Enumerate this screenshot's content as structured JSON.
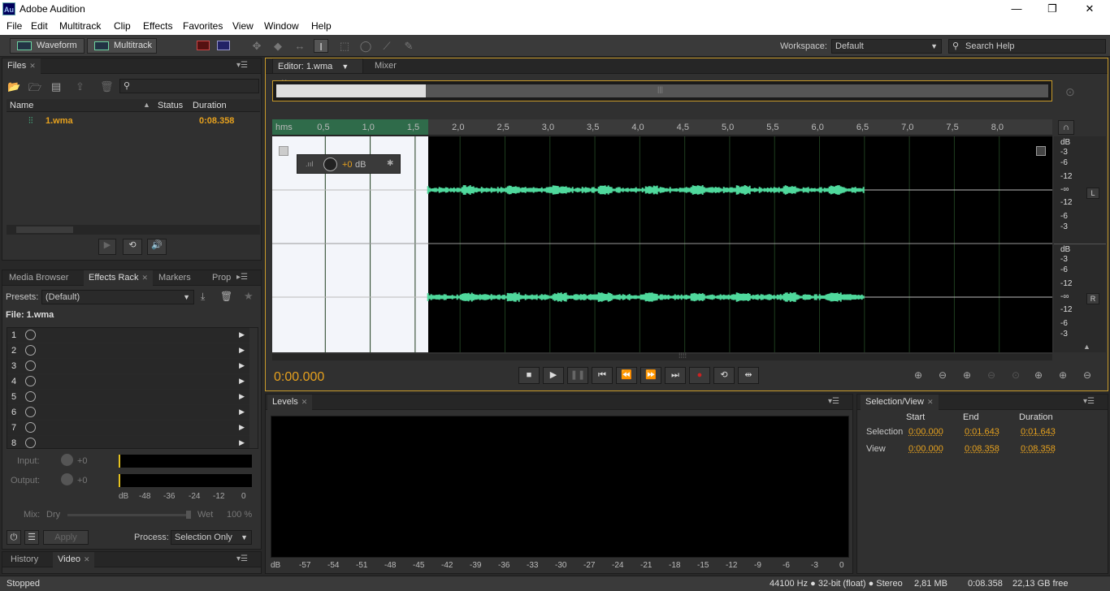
{
  "window": {
    "title": "Adobe Audition",
    "icon_text": "Au",
    "minimize": "—",
    "maximize": "❐",
    "close": "✕"
  },
  "menu": [
    "File",
    "Edit",
    "Multitrack",
    "Clip",
    "Effects",
    "Favorites",
    "View",
    "Window",
    "Help"
  ],
  "toolbar": {
    "waveform": "Waveform",
    "multitrack": "Multitrack",
    "workspace_label": "Workspace:",
    "workspace_value": "Default",
    "search_placeholder": "Search Help"
  },
  "files": {
    "tab": "Files",
    "columns": {
      "name": "Name",
      "status": "Status",
      "duration": "Duration"
    },
    "rows": [
      {
        "name": "1.wma",
        "status": "",
        "duration": "0:08.358"
      }
    ]
  },
  "effects": {
    "tabs": [
      "Media Browser",
      "Effects Rack",
      "Markers",
      "Prop"
    ],
    "presets_label": "Presets:",
    "presets_value": "(Default)",
    "file_label": "File: 1.wma",
    "slots": [
      "1",
      "2",
      "3",
      "4",
      "5",
      "6",
      "7",
      "8"
    ],
    "input_label": "Input:",
    "output_label": "Output:",
    "input_value": "+0",
    "output_value": "+0",
    "meter_scale": [
      "dB",
      "-48",
      "-36",
      "-24",
      "-12",
      "0"
    ],
    "mix_label": "Mix:",
    "mix_dry": "Dry",
    "mix_wet": "Wet",
    "mix_value": "100 %",
    "apply": "Apply",
    "process_label": "Process:",
    "process_value": "Selection Only"
  },
  "bottom_tabs": [
    "History",
    "Video"
  ],
  "editor": {
    "tab": "Editor: 1.wma",
    "mixer_tab": "Mixer",
    "ruler": [
      "hms",
      "0,5",
      "1,0",
      "1,5",
      "2,0",
      "2,5",
      "3,0",
      "3,5",
      "4,0",
      "4,5",
      "5,0",
      "5,5",
      "6,0",
      "6,5",
      "7,0",
      "7,5",
      "8,0"
    ],
    "hud_value": "+0",
    "hud_unit": "dB",
    "db_scale_top": [
      "dB",
      "-3",
      "-6",
      "-12",
      "-∞",
      "-12",
      "-6",
      "-3"
    ],
    "db_scale_bottom": [
      "dB",
      "-3",
      "-6",
      "-12",
      "-∞",
      "-12",
      "-6",
      "-3"
    ],
    "channel_L": "L",
    "channel_R": "R",
    "time_display": "0:00.000",
    "duration_seconds": 8.358,
    "selection_end_seconds": 1.643
  },
  "levels": {
    "tab": "Levels",
    "scale": [
      "dB",
      "-57",
      "-54",
      "-51",
      "-48",
      "-45",
      "-42",
      "-39",
      "-36",
      "-33",
      "-30",
      "-27",
      "-24",
      "-21",
      "-18",
      "-15",
      "-12",
      "-9",
      "-6",
      "-3",
      "0"
    ]
  },
  "selection_view": {
    "tab": "Selection/View",
    "headers": [
      "Start",
      "End",
      "Duration"
    ],
    "selection_label": "Selection",
    "selection": [
      "0:00.000",
      "0:01.643",
      "0:01.643"
    ],
    "view_label": "View",
    "view": [
      "0:00.000",
      "0:08.358",
      "0:08.358"
    ]
  },
  "status": {
    "left": "Stopped",
    "format": "44100 Hz ● 32-bit (float) ● Stereo",
    "size": "2,81 MB",
    "duration": "0:08.358",
    "free": "22,13 GB free"
  },
  "colors": {
    "accent": "#e6a11e",
    "waveform": "#4fd89c",
    "ruler_selection": "#2f6b4a"
  }
}
